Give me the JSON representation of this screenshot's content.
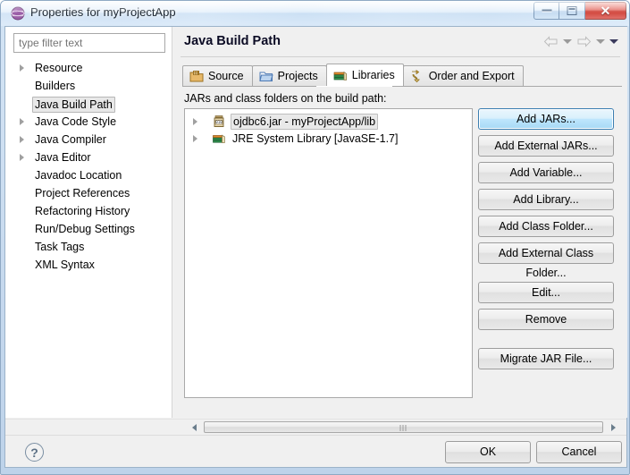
{
  "window": {
    "title": "Properties for myProjectApp",
    "icon": "eclipse-sphere-icon",
    "controls": {
      "minimize": "Minimize",
      "maximize": "Maximize",
      "close": "Close"
    }
  },
  "sidebar": {
    "filter": {
      "placeholder": "type filter text",
      "value": ""
    },
    "items": [
      {
        "label": "Resource",
        "expandable": true,
        "selected": false
      },
      {
        "label": "Builders",
        "expandable": false,
        "selected": false
      },
      {
        "label": "Java Build Path",
        "expandable": false,
        "selected": true
      },
      {
        "label": "Java Code Style",
        "expandable": true,
        "selected": false
      },
      {
        "label": "Java Compiler",
        "expandable": true,
        "selected": false
      },
      {
        "label": "Java Editor",
        "expandable": true,
        "selected": false
      },
      {
        "label": "Javadoc Location",
        "expandable": false,
        "selected": false
      },
      {
        "label": "Project References",
        "expandable": false,
        "selected": false
      },
      {
        "label": "Refactoring History",
        "expandable": false,
        "selected": false
      },
      {
        "label": "Run/Debug Settings",
        "expandable": false,
        "selected": false
      },
      {
        "label": "Task Tags",
        "expandable": false,
        "selected": false
      },
      {
        "label": "XML Syntax",
        "expandable": false,
        "selected": false
      }
    ]
  },
  "page": {
    "title": "Java Build Path",
    "nav": {
      "back": "back-arrow",
      "back_menu": "back-dropdown",
      "forward": "forward-arrow",
      "forward_menu": "forward-dropdown",
      "view_menu": "view-menu"
    },
    "tabs": [
      {
        "label": "Source",
        "icon": "source-folder-icon",
        "active": false
      },
      {
        "label": "Projects",
        "icon": "project-folder-icon",
        "active": false
      },
      {
        "label": "Libraries",
        "icon": "libraries-books-icon",
        "active": true
      },
      {
        "label": "Order and Export",
        "icon": "order-export-icon",
        "active": false
      }
    ],
    "list_label": "JARs and class folders on the build path:",
    "list_items": [
      {
        "label": "ojdbc6.jar - myProjectApp/lib",
        "icon": "jar-icon",
        "expandable": true,
        "selected": true
      },
      {
        "label": "JRE System Library [JavaSE-1.7]",
        "icon": "library-icon",
        "expandable": true,
        "selected": false
      }
    ],
    "buttons": [
      {
        "label": "Add JARs...",
        "focused": true
      },
      {
        "label": "Add External JARs...",
        "focused": false
      },
      {
        "label": "Add Variable...",
        "focused": false
      },
      {
        "label": "Add Library...",
        "focused": false
      },
      {
        "label": "Add Class Folder...",
        "focused": false
      },
      {
        "label": "Add External Class Folder...",
        "focused": false
      }
    ],
    "buttons2": [
      {
        "label": "Edit...",
        "focused": false
      },
      {
        "label": "Remove",
        "focused": false
      }
    ],
    "buttons3": [
      {
        "label": "Migrate JAR File...",
        "focused": false
      }
    ]
  },
  "footer": {
    "help": "?",
    "ok": "OK",
    "cancel": "Cancel"
  },
  "colors": {
    "titlebar_blue": "#cfe1f4",
    "close_red": "#cf4036",
    "focus_blue": "#3c7fb1",
    "selection_gray": "#e9e9e9"
  }
}
